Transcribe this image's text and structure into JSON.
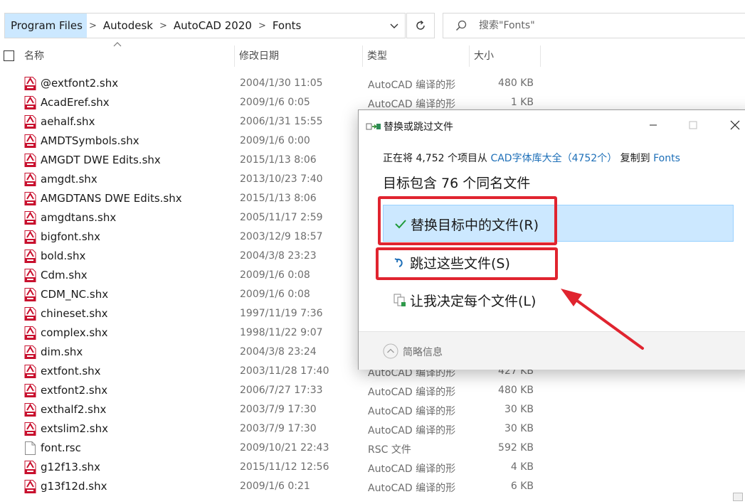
{
  "address_bar": {
    "breadcrumbs": [
      "Program Files",
      "Autodesk",
      "AutoCAD 2020",
      "Fonts"
    ],
    "separator": ">"
  },
  "search": {
    "placeholder": "搜索\"Fonts\""
  },
  "columns": {
    "name": "名称",
    "date": "修改日期",
    "type": "类型",
    "size": "大小"
  },
  "files": [
    {
      "name": "@extfont2.shx",
      "date": "2004/1/30 11:05",
      "type": "AutoCAD 编译的形",
      "size": "480 KB",
      "icon": "shx-file-icon"
    },
    {
      "name": "AcadEref.shx",
      "date": "2009/1/6 0:05",
      "type": "AutoCAD 编译的形",
      "size": "1 KB",
      "icon": "shx-file-icon"
    },
    {
      "name": "aehalf.shx",
      "date": "2006/1/31 15:55",
      "type": "",
      "size": "",
      "icon": "shx-file-icon"
    },
    {
      "name": "AMDTSymbols.shx",
      "date": "2009/1/6 0:00",
      "type": "",
      "size": "",
      "icon": "shx-file-icon"
    },
    {
      "name": "AMGDT DWE Edits.shx",
      "date": "2015/1/13 8:06",
      "type": "",
      "size": "",
      "icon": "shx-file-icon"
    },
    {
      "name": "amgdt.shx",
      "date": "2013/10/23 7:40",
      "type": "",
      "size": "",
      "icon": "shx-file-icon"
    },
    {
      "name": "AMGDTANS DWE Edits.shx",
      "date": "2015/1/13 8:06",
      "type": "",
      "size": "",
      "icon": "shx-file-icon"
    },
    {
      "name": "amgdtans.shx",
      "date": "2005/11/17 2:59",
      "type": "",
      "size": "",
      "icon": "shx-file-icon"
    },
    {
      "name": "bigfont.shx",
      "date": "2003/12/9 18:57",
      "type": "",
      "size": "",
      "icon": "shx-file-icon"
    },
    {
      "name": "bold.shx",
      "date": "2004/3/8 23:23",
      "type": "",
      "size": "",
      "icon": "shx-file-icon"
    },
    {
      "name": "Cdm.shx",
      "date": "2009/1/6 0:08",
      "type": "",
      "size": "",
      "icon": "shx-file-icon"
    },
    {
      "name": "CDM_NC.shx",
      "date": "2009/1/6 0:08",
      "type": "",
      "size": "",
      "icon": "shx-file-icon"
    },
    {
      "name": "chineset.shx",
      "date": "1997/11/19 7:36",
      "type": "",
      "size": "",
      "icon": "shx-file-icon"
    },
    {
      "name": "complex.shx",
      "date": "1998/11/22 9:07",
      "type": "",
      "size": "",
      "icon": "shx-file-icon"
    },
    {
      "name": "dim.shx",
      "date": "2004/3/8 23:24",
      "type": "",
      "size": "",
      "icon": "shx-file-icon"
    },
    {
      "name": "extfont.shx",
      "date": "2003/11/28 17:40",
      "type": "AutoCAD 编译的形",
      "size": "427 KB",
      "icon": "shx-file-icon"
    },
    {
      "name": "extfont2.shx",
      "date": "2006/7/27 17:33",
      "type": "AutoCAD 编译的形",
      "size": "480 KB",
      "icon": "shx-file-icon"
    },
    {
      "name": "exthalf2.shx",
      "date": "2003/7/9 17:30",
      "type": "AutoCAD 编译的形",
      "size": "30 KB",
      "icon": "shx-file-icon"
    },
    {
      "name": "extslim2.shx",
      "date": "2003/7/9 17:30",
      "type": "AutoCAD 编译的形",
      "size": "30 KB",
      "icon": "shx-file-icon"
    },
    {
      "name": "font.rsc",
      "date": "2009/10/21 22:43",
      "type": "RSC 文件",
      "size": "592 KB",
      "icon": "generic-file-icon"
    },
    {
      "name": "g12f13.shx",
      "date": "2015/11/12 12:56",
      "type": "AutoCAD 编译的形",
      "size": "4 KB",
      "icon": "shx-file-icon"
    },
    {
      "name": "g13f12d.shx",
      "date": "2009/1/6 0:21",
      "type": "AutoCAD 编译的形",
      "size": "6 KB",
      "icon": "shx-file-icon"
    }
  ],
  "dialog": {
    "title": "替换或跳过文件",
    "info_prefix": "正在将 4,752 个项目从",
    "info_source": "CAD字体库大全（4752个）",
    "info_mid": "复制到",
    "info_dest": "Fonts",
    "heading": "目标包含 76 个同名文件",
    "option_replace": "替换目标中的文件(R)",
    "option_skip": "跳过这些文件(S)",
    "option_decide": "让我决定每个文件(L)",
    "details": "简略信息"
  },
  "colors": {
    "selection_bg": "#cce8ff",
    "annotation_red": "#e0242f",
    "link_blue": "#1d6fb8",
    "shx_icon_red": "#c8102e"
  }
}
